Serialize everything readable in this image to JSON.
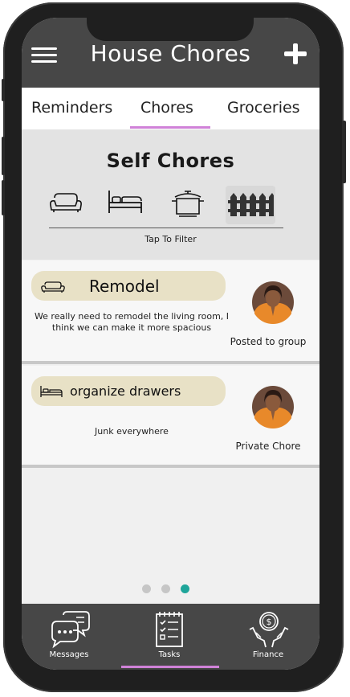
{
  "header": {
    "title": "House Chores",
    "menu_icon": "hamburger-menu-icon",
    "add_icon": "plus-icon"
  },
  "tabs": [
    {
      "label": "Reminders"
    },
    {
      "label": "Chores",
      "active": true
    },
    {
      "label": "Groceries"
    }
  ],
  "filter": {
    "title": "Self Chores",
    "hint": "Tap To Filter",
    "icons": [
      "sofa-icon",
      "bed-icon",
      "pot-icon",
      "fence-icon"
    ],
    "selected": "fence-icon"
  },
  "chores": [
    {
      "title": "Remodel",
      "icon": "sofa-icon",
      "description": "We really need to remodel the living room, I think we can make it more spacious",
      "status": "Posted to group"
    },
    {
      "title": "organize drawers",
      "icon": "bed-icon",
      "description": "Junk everywhere",
      "status": "Private Chore"
    }
  ],
  "pager": {
    "count": 3,
    "active": 3
  },
  "colors": {
    "header": "#474747",
    "accent": "#d082d8",
    "pill": "#e8e1c6",
    "active_dot": "#1ea59a"
  },
  "bottom_nav": [
    {
      "label": "Messages",
      "icon": "chat-bubbles-icon"
    },
    {
      "label": "Tasks",
      "icon": "checklist-icon",
      "active": true
    },
    {
      "label": "Finance",
      "icon": "money-hands-icon"
    }
  ]
}
